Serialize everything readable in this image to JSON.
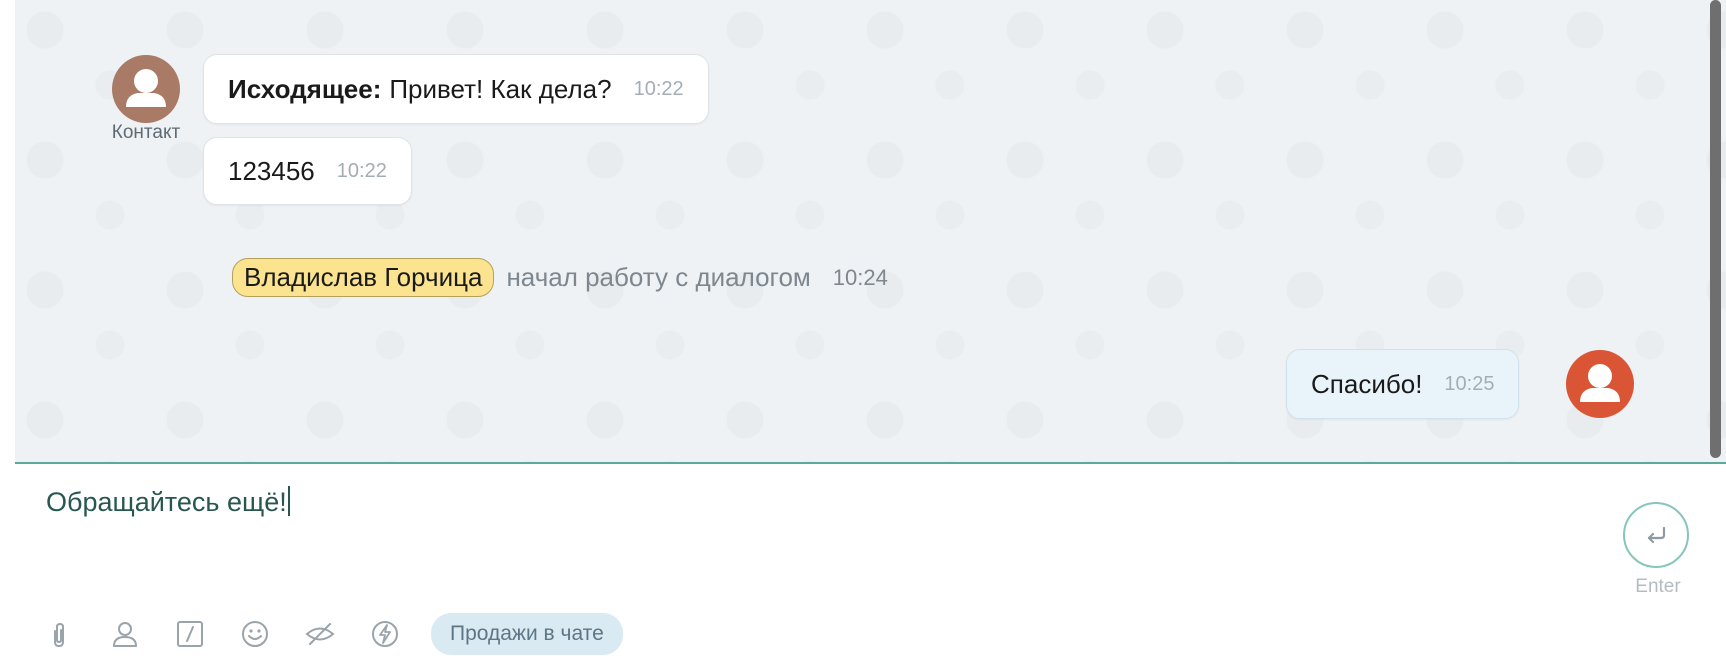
{
  "contact": {
    "caption": "Контакт"
  },
  "messages": [
    {
      "prefix": "Исходящее:",
      "text": "Привет! Как дела?",
      "time": "10:22"
    },
    {
      "text": "123456",
      "time": "10:22"
    },
    {
      "text": "Спасибо!",
      "time": "10:25"
    }
  ],
  "system_event": {
    "operator": "Владислав Горчица",
    "text": "начал работу с диалогом",
    "time": "10:24"
  },
  "composer": {
    "value": "Обращайтесь ещё!",
    "send_label": "Enter"
  },
  "toolbar": {
    "icons": [
      "paperclip-icon",
      "person-icon",
      "slash-command-icon",
      "smiley-icon",
      "eye-hidden-icon",
      "lightning-icon"
    ],
    "chip_label": "Продажи в чате"
  },
  "colors": {
    "accent": "#5aa999",
    "operator_avatar": "#d95536",
    "contact_avatar": "#a97a66",
    "name_chip": "#fbe390"
  }
}
